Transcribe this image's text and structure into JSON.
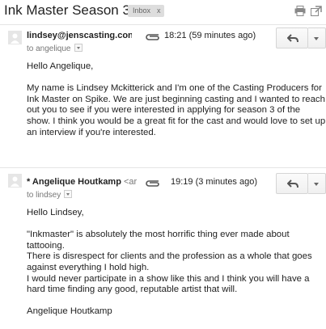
{
  "thread": {
    "subject": "Ink Master Season 3!",
    "label": "Inbox",
    "label_close": "x"
  },
  "messages": [
    {
      "sender": "lindsey@jenscasting.con",
      "sender_tail": "",
      "to": "to angelique",
      "time": "18:21 (59 minutes ago)",
      "paragraphs": [
        "Hello Angelique,",
        "My name is Lindsey Mckitterick and I'm one of the Casting Producers for Ink Master on Spike. We are just beginning casting and  I wanted to reach out you to see if you were interested in applying for season 3 of the show. I think you would be a great fit for the cast and would love to set up an interview if you're interested."
      ]
    },
    {
      "sender": "* Angelique Houtkamp",
      "sender_tail": " <ar",
      "to": "to lindsey",
      "time": "19:19 (3 minutes ago)",
      "paragraphs": [
        "Hello Lindsey,",
        "\"Inkmaster\" is absolutely the most horrific thing ever made about tattooing.\nThere is disrespect for clients and the profession as a whole that goes against everything I hold high.\nI would never participate in a show like this and I think you will have a hard time finding any good, reputable artist that will.",
        "Angelique Houtkamp"
      ]
    }
  ],
  "icons": {
    "print": "print-icon",
    "new_window": "new-window-icon",
    "attachment": "paperclip-icon",
    "reply": "reply-icon",
    "more": "chevron-down-icon"
  }
}
